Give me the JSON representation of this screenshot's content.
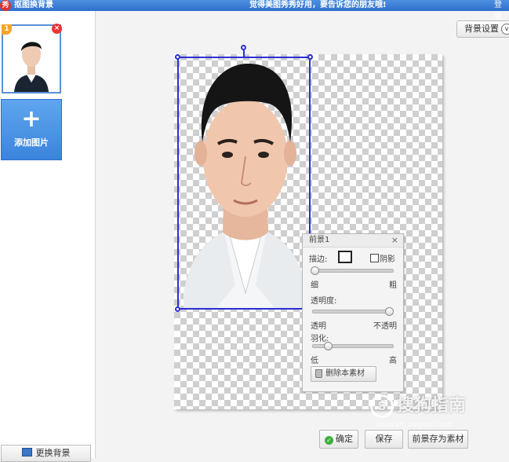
{
  "titlebar": {
    "logo_char": "秀",
    "app_title": "抠图换背景",
    "slogan": "觉得美图秀秀好用，要告诉您的朋友哦!",
    "login": "登录"
  },
  "sidebar": {
    "thumb_badge": "1",
    "thumb_close": "×",
    "add_plus": "+",
    "add_label": "添加图片",
    "change_bg_label": "更换背景"
  },
  "toolbar": {
    "bg_settings_label": "背景设置",
    "bg_settings_chevron": "v"
  },
  "panel": {
    "title": "前景1",
    "close": "×",
    "stroke_label": "描边:",
    "shadow_label": "阴影",
    "thin_label": "细",
    "thick_label": "粗",
    "opacity_label": "透明度:",
    "transparent_label": "透明",
    "opaque_label": "不透明",
    "feather_label": "羽化:",
    "low_label": "低",
    "high_label": "高",
    "delete_label": "删除本素材",
    "stroke_width": 0.0,
    "opacity": 1.0,
    "feather": 0.2
  },
  "buttons": {
    "ok": "确定",
    "ok_icon": "✓",
    "save": "保存",
    "save_as_material": "前景存为素材"
  },
  "watermark": {
    "logo": "S",
    "text": "搜狗指南",
    "sub": "zhinan.sogou.com"
  },
  "colors": {
    "accent": "#2f6fcc",
    "selection": "#2b2fd4"
  }
}
